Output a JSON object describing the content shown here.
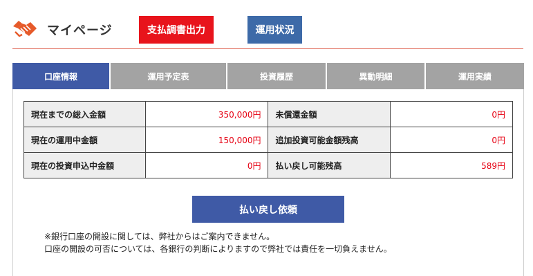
{
  "header": {
    "title": "マイページ",
    "icon": "handshake-icon",
    "btn_payment_report": "支払調書出力",
    "btn_operation_status": "運用状況"
  },
  "tabs": [
    {
      "label": "口座情報",
      "active": true
    },
    {
      "label": "運用予定表",
      "active": false
    },
    {
      "label": "投資履歴",
      "active": false
    },
    {
      "label": "異動明細",
      "active": false
    },
    {
      "label": "運用実績",
      "active": false
    }
  ],
  "summary": {
    "rows": [
      {
        "left_label": "現在までの総入金額",
        "left_value": "350,000円",
        "right_label": "未償還金額",
        "right_value": "0円"
      },
      {
        "left_label": "現在の運用中金額",
        "left_value": "150,000円",
        "right_label": "追加投資可能金額残高",
        "right_value": "0円"
      },
      {
        "left_label": "現在の投資申込中金額",
        "left_value": "0円",
        "right_label": "払い戻し可能残高",
        "right_value": "589円"
      }
    ]
  },
  "refund_button": "払い戻し依頼",
  "notes": [
    "※銀行口座の開設に関しては、弊社からはご案内できません。",
    "口座の開設の可否については、各銀行の判断によりますので弊社では責任を一切負えません。"
  ],
  "colors": {
    "accent_red": "#e8141c",
    "blue": "#3d6aa8",
    "tab_active": "#3f5aa6",
    "tab_inactive": "#a3a3a3",
    "value_red": "#e60012"
  }
}
